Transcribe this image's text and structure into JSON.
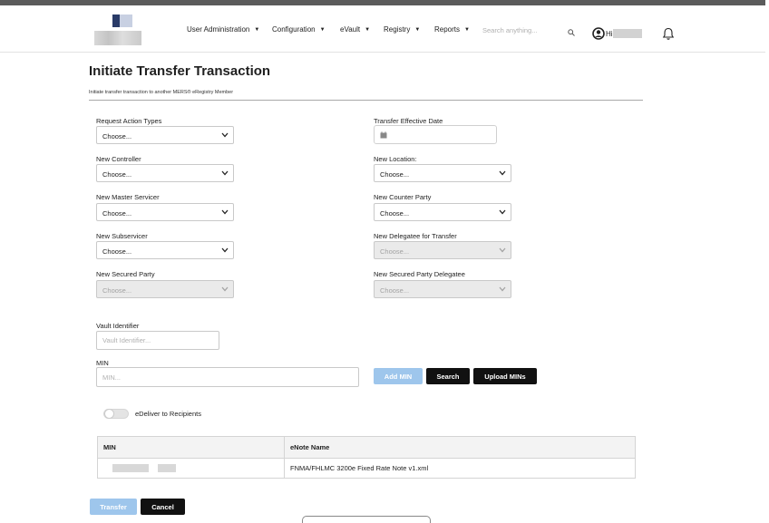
{
  "nav": {
    "user_admin": "User Administration",
    "configuration": "Configuration",
    "evault": "eVault",
    "registry": "Registry",
    "reports": "Reports",
    "search_placeholder": "Search anything...",
    "greeting": "Hi"
  },
  "page": {
    "title": "Initiate Transfer Transaction",
    "subtitle": "Initiate transfer transaction to another MERS® eRegistry Member"
  },
  "form": {
    "request_action_types": {
      "label": "Request Action Types",
      "value": "Choose..."
    },
    "transfer_effective_date": {
      "label": "Transfer Effective Date"
    },
    "new_controller": {
      "label": "New Controller",
      "value": "Choose..."
    },
    "new_location": {
      "label": "New Location:",
      "value": "Choose..."
    },
    "new_master_servicer": {
      "label": "New Master Servicer",
      "value": "Choose..."
    },
    "new_counter_party": {
      "label": "New Counter Party",
      "value": "Choose..."
    },
    "new_subservicer": {
      "label": "New Subservicer",
      "value": "Choose..."
    },
    "new_delegatee_for_transfer": {
      "label": "New Delegatee for Transfer",
      "value": "Choose..."
    },
    "new_secured_party": {
      "label": "New Secured Party",
      "value": "Choose..."
    },
    "new_secured_party_delegatee": {
      "label": "New Secured Party Delegatee",
      "value": "Choose..."
    },
    "vault_identifier": {
      "label": "Vault Identifier",
      "placeholder": "Vault Identifier..."
    },
    "min": {
      "label": "MIN",
      "placeholder": "MIN..."
    }
  },
  "buttons": {
    "add_min": "Add MIN",
    "search": "Search",
    "upload_mins": "Upload MINs",
    "transfer": "Transfer",
    "cancel": "Cancel"
  },
  "toggle": {
    "label": "eDeliver to Recipients",
    "on": false
  },
  "table": {
    "headers": [
      "MIN",
      "eNote Name"
    ],
    "rows": [
      {
        "enote_name": "FNMA/FHLMC 3200e Fixed Rate Note v1.xml"
      }
    ]
  },
  "colors": {
    "primary_dark": "#111111",
    "disabled_blue": "#9ec6ec",
    "header_bar": "#5b5b5b"
  }
}
